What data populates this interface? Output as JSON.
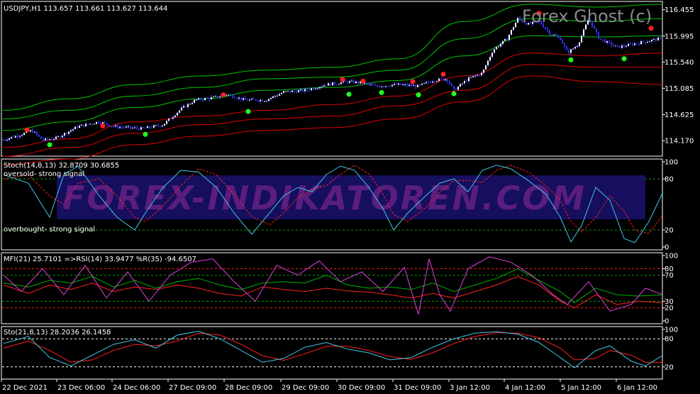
{
  "brand_watermark": "Forex Ghost (c)",
  "site_watermark": "FOREX-INDIKATOREN.COM",
  "chart_data": [
    {
      "type": "line",
      "name": "price",
      "title": "USDJPY,H1  113.657 113.661 113.627 113.644",
      "ylim": [
        113.95,
        116.55
      ],
      "y_ticks": [
        "116.455",
        "115.995",
        "115.540",
        "115.085",
        "114.625",
        "114.170"
      ],
      "price_path": [
        [
          0,
          114.17
        ],
        [
          30,
          114.28
        ],
        [
          45,
          114.35
        ],
        [
          60,
          114.18
        ],
        [
          80,
          114.22
        ],
        [
          110,
          114.42
        ],
        [
          140,
          114.5
        ],
        [
          160,
          114.42
        ],
        [
          200,
          114.38
        ],
        [
          230,
          114.45
        ],
        [
          255,
          114.72
        ],
        [
          275,
          114.88
        ],
        [
          300,
          114.92
        ],
        [
          320,
          114.98
        ],
        [
          345,
          114.88
        ],
        [
          375,
          114.88
        ],
        [
          400,
          115.02
        ],
        [
          430,
          115.05
        ],
        [
          460,
          115.15
        ],
        [
          490,
          115.2
        ],
        [
          510,
          115.18
        ],
        [
          530,
          115.12
        ],
        [
          560,
          115.15
        ],
        [
          590,
          115.12
        ],
        [
          610,
          115.22
        ],
        [
          630,
          115.25
        ],
        [
          640,
          115.05
        ],
        [
          660,
          115.25
        ],
        [
          680,
          115.35
        ],
        [
          695,
          115.75
        ],
        [
          715,
          115.95
        ],
        [
          730,
          116.3
        ],
        [
          745,
          116.2
        ],
        [
          760,
          116.25
        ],
        [
          775,
          116.05
        ],
        [
          790,
          115.95
        ],
        [
          800,
          115.7
        ],
        [
          815,
          115.85
        ],
        [
          830,
          116.3
        ],
        [
          845,
          115.95
        ],
        [
          870,
          115.8
        ],
        [
          890,
          115.85
        ],
        [
          910,
          115.9
        ],
        [
          930,
          115.95
        ]
      ],
      "band_upper_green": [
        114.7,
        114.9,
        115.15,
        115.3,
        115.4,
        115.45,
        115.6,
        116.25,
        116.55,
        116.5,
        116.55
      ],
      "band_middle_green": [
        114.55,
        114.7,
        114.95,
        115.1,
        115.25,
        115.28,
        115.4,
        115.95,
        116.3,
        116.25,
        116.3
      ],
      "band_lower_green": [
        114.35,
        114.5,
        114.75,
        114.9,
        115.05,
        115.1,
        115.22,
        115.65,
        116.0,
        115.98,
        116.0
      ],
      "band_upper_red": [
        114.05,
        114.2,
        114.5,
        114.6,
        114.7,
        114.8,
        114.95,
        115.3,
        115.7,
        115.65,
        115.7
      ],
      "band_middle_red": [
        113.9,
        114.05,
        114.3,
        114.45,
        114.55,
        114.6,
        114.78,
        115.05,
        115.5,
        115.45,
        115.45
      ],
      "band_lower_red": [
        113.75,
        113.85,
        114.1,
        114.25,
        114.35,
        114.4,
        114.55,
        114.85,
        115.3,
        115.2,
        115.15
      ],
      "sell_signals": [
        [
          38,
          114.36
        ],
        [
          145,
          114.43
        ],
        [
          315,
          114.97
        ],
        [
          483,
          115.24
        ],
        [
          512,
          115.21
        ],
        [
          582,
          115.2
        ],
        [
          625,
          115.33
        ],
        [
          760,
          116.39
        ],
        [
          918,
          116.13
        ]
      ],
      "buy_signals": [
        [
          70,
          114.1
        ],
        [
          205,
          114.28
        ],
        [
          350,
          114.68
        ],
        [
          492,
          114.98
        ],
        [
          538,
          115.01
        ],
        [
          590,
          114.97
        ],
        [
          640,
          114.99
        ],
        [
          805,
          115.58
        ],
        [
          880,
          115.6
        ]
      ]
    },
    {
      "type": "line",
      "name": "stoch",
      "title": "Stoch(14,8,13) 32.8709 30.6855",
      "ylim": [
        0,
        100
      ],
      "y_ticks": [
        "100",
        "80",
        "20",
        "0"
      ],
      "annotations": [
        "oversold-  strong signal",
        "overbought- strong signal"
      ],
      "main": [
        [
          5,
          85
        ],
        [
          40,
          75
        ],
        [
          70,
          35
        ],
        [
          90,
          85
        ],
        [
          110,
          95
        ],
        [
          140,
          60
        ],
        [
          165,
          35
        ],
        [
          190,
          20
        ],
        [
          205,
          40
        ],
        [
          230,
          70
        ],
        [
          255,
          90
        ],
        [
          280,
          88
        ],
        [
          305,
          70
        ],
        [
          330,
          40
        ],
        [
          355,
          15
        ],
        [
          380,
          40
        ],
        [
          400,
          60
        ],
        [
          420,
          70
        ],
        [
          440,
          65
        ],
        [
          460,
          85
        ],
        [
          480,
          95
        ],
        [
          500,
          90
        ],
        [
          520,
          70
        ],
        [
          540,
          45
        ],
        [
          555,
          20
        ],
        [
          575,
          40
        ],
        [
          600,
          60
        ],
        [
          620,
          75
        ],
        [
          640,
          80
        ],
        [
          660,
          65
        ],
        [
          680,
          90
        ],
        [
          700,
          96
        ],
        [
          720,
          92
        ],
        [
          745,
          78
        ],
        [
          770,
          62
        ],
        [
          790,
          35
        ],
        [
          805,
          6
        ],
        [
          820,
          25
        ],
        [
          840,
          70
        ],
        [
          860,
          55
        ],
        [
          880,
          10
        ],
        [
          895,
          5
        ],
        [
          915,
          30
        ],
        [
          935,
          65
        ]
      ],
      "signal": [
        [
          5,
          80
        ],
        [
          40,
          85
        ],
        [
          70,
          60
        ],
        [
          90,
          50
        ],
        [
          110,
          75
        ],
        [
          140,
          80
        ],
        [
          165,
          60
        ],
        [
          190,
          35
        ],
        [
          205,
          30
        ],
        [
          230,
          48
        ],
        [
          255,
          72
        ],
        [
          280,
          92
        ],
        [
          305,
          85
        ],
        [
          330,
          62
        ],
        [
          355,
          36
        ],
        [
          380,
          26
        ],
        [
          400,
          40
        ],
        [
          420,
          58
        ],
        [
          440,
          68
        ],
        [
          460,
          72
        ],
        [
          480,
          85
        ],
        [
          500,
          96
        ],
        [
          520,
          86
        ],
        [
          540,
          62
        ],
        [
          555,
          38
        ],
        [
          575,
          30
        ],
        [
          600,
          46
        ],
        [
          620,
          64
        ],
        [
          640,
          78
        ],
        [
          660,
          78
        ],
        [
          680,
          76
        ],
        [
          700,
          90
        ],
        [
          720,
          96
        ],
        [
          745,
          88
        ],
        [
          770,
          72
        ],
        [
          790,
          55
        ],
        [
          805,
          30
        ],
        [
          820,
          18
        ],
        [
          840,
          35
        ],
        [
          860,
          60
        ],
        [
          880,
          42
        ],
        [
          895,
          20
        ],
        [
          915,
          16
        ],
        [
          935,
          38
        ]
      ]
    },
    {
      "type": "line",
      "name": "mfi_rsi",
      "title": "MFI(21) 25.7101  =>RSI(14) 33.9477  %R(35) -94.6507",
      "ylim": [
        0,
        100
      ],
      "y_ticks": [
        "100",
        "80",
        "70",
        "30",
        "20",
        "0"
      ],
      "mfi": [
        [
          5,
          55
        ],
        [
          40,
          42
        ],
        [
          70,
          55
        ],
        [
          100,
          48
        ],
        [
          130,
          58
        ],
        [
          160,
          45
        ],
        [
          190,
          52
        ],
        [
          220,
          48
        ],
        [
          250,
          55
        ],
        [
          280,
          50
        ],
        [
          310,
          42
        ],
        [
          340,
          38
        ],
        [
          370,
          52
        ],
        [
          400,
          48
        ],
        [
          430,
          45
        ],
        [
          460,
          50
        ],
        [
          490,
          46
        ],
        [
          520,
          44
        ],
        [
          550,
          40
        ],
        [
          580,
          35
        ],
        [
          610,
          42
        ],
        [
          640,
          35
        ],
        [
          670,
          45
        ],
        [
          700,
          55
        ],
        [
          730,
          68
        ],
        [
          760,
          55
        ],
        [
          790,
          30
        ],
        [
          810,
          20
        ],
        [
          840,
          40
        ],
        [
          870,
          25
        ],
        [
          900,
          30
        ],
        [
          935,
          28
        ]
      ],
      "rsi": [
        [
          5,
          58
        ],
        [
          40,
          52
        ],
        [
          70,
          62
        ],
        [
          100,
          58
        ],
        [
          130,
          68
        ],
        [
          160,
          52
        ],
        [
          190,
          62
        ],
        [
          220,
          50
        ],
        [
          250,
          60
        ],
        [
          280,
          65
        ],
        [
          310,
          55
        ],
        [
          340,
          48
        ],
        [
          370,
          58
        ],
        [
          400,
          60
        ],
        [
          430,
          58
        ],
        [
          460,
          70
        ],
        [
          490,
          55
        ],
        [
          520,
          50
        ],
        [
          550,
          52
        ],
        [
          580,
          48
        ],
        [
          610,
          58
        ],
        [
          640,
          45
        ],
        [
          670,
          55
        ],
        [
          700,
          65
        ],
        [
          730,
          80
        ],
        [
          760,
          62
        ],
        [
          790,
          45
        ],
        [
          810,
          28
        ],
        [
          840,
          50
        ],
        [
          870,
          40
        ],
        [
          900,
          38
        ],
        [
          935,
          40
        ]
      ],
      "wpr": [
        [
          5,
          70
        ],
        [
          30,
          45
        ],
        [
          60,
          80
        ],
        [
          90,
          40
        ],
        [
          120,
          85
        ],
        [
          150,
          35
        ],
        [
          180,
          75
        ],
        [
          210,
          30
        ],
        [
          240,
          70
        ],
        [
          270,
          90
        ],
        [
          300,
          95
        ],
        [
          330,
          60
        ],
        [
          360,
          30
        ],
        [
          390,
          85
        ],
        [
          420,
          70
        ],
        [
          450,
          92
        ],
        [
          480,
          60
        ],
        [
          510,
          75
        ],
        [
          540,
          45
        ],
        [
          570,
          82
        ],
        [
          590,
          10
        ],
        [
          605,
          95
        ],
        [
          620,
          40
        ],
        [
          635,
          15
        ],
        [
          660,
          80
        ],
        [
          690,
          98
        ],
        [
          720,
          90
        ],
        [
          750,
          70
        ],
        [
          780,
          40
        ],
        [
          800,
          25
        ],
        [
          830,
          60
        ],
        [
          860,
          15
        ],
        [
          890,
          25
        ],
        [
          910,
          50
        ],
        [
          935,
          40
        ]
      ]
    },
    {
      "type": "line",
      "name": "sto",
      "title": "Sto(21,8,13) 28.2036 26.1458",
      "ylim": [
        0,
        100
      ],
      "y_ticks": [
        "100",
        "80",
        "20"
      ],
      "main": [
        [
          5,
          70
        ],
        [
          40,
          85
        ],
        [
          70,
          40
        ],
        [
          100,
          22
        ],
        [
          130,
          45
        ],
        [
          160,
          68
        ],
        [
          190,
          78
        ],
        [
          220,
          60
        ],
        [
          250,
          88
        ],
        [
          280,
          96
        ],
        [
          310,
          80
        ],
        [
          340,
          55
        ],
        [
          370,
          30
        ],
        [
          400,
          38
        ],
        [
          430,
          62
        ],
        [
          460,
          72
        ],
        [
          490,
          58
        ],
        [
          520,
          50
        ],
        [
          550,
          35
        ],
        [
          580,
          40
        ],
        [
          610,
          62
        ],
        [
          640,
          80
        ],
        [
          670,
          92
        ],
        [
          700,
          95
        ],
        [
          730,
          90
        ],
        [
          760,
          72
        ],
        [
          790,
          40
        ],
        [
          810,
          18
        ],
        [
          840,
          55
        ],
        [
          860,
          65
        ],
        [
          890,
          32
        ],
        [
          910,
          22
        ],
        [
          935,
          45
        ]
      ],
      "signal": [
        [
          5,
          60
        ],
        [
          40,
          75
        ],
        [
          70,
          55
        ],
        [
          100,
          30
        ],
        [
          130,
          35
        ],
        [
          160,
          55
        ],
        [
          190,
          68
        ],
        [
          220,
          65
        ],
        [
          250,
          75
        ],
        [
          280,
          92
        ],
        [
          310,
          88
        ],
        [
          340,
          68
        ],
        [
          370,
          44
        ],
        [
          400,
          34
        ],
        [
          430,
          48
        ],
        [
          460,
          64
        ],
        [
          490,
          64
        ],
        [
          520,
          55
        ],
        [
          550,
          42
        ],
        [
          580,
          36
        ],
        [
          610,
          50
        ],
        [
          640,
          70
        ],
        [
          670,
          85
        ],
        [
          700,
          93
        ],
        [
          730,
          92
        ],
        [
          760,
          82
        ],
        [
          790,
          60
        ],
        [
          810,
          35
        ],
        [
          840,
          38
        ],
        [
          860,
          55
        ],
        [
          890,
          45
        ],
        [
          910,
          30
        ],
        [
          935,
          30
        ]
      ]
    }
  ],
  "x_labels": [
    "22 Dec 2021",
    "23 Dec 06:00",
    "24 Dec 06:00",
    "27 Dec 09:00",
    "28 Dec 09:00",
    "29 Dec 09:00",
    "30 Dec 09:00",
    "31 Dec 09:00",
    "3 Jan 12:00",
    "4 Jan 12:00",
    "5 Jan 12:00",
    "6 Jan 12:00"
  ]
}
